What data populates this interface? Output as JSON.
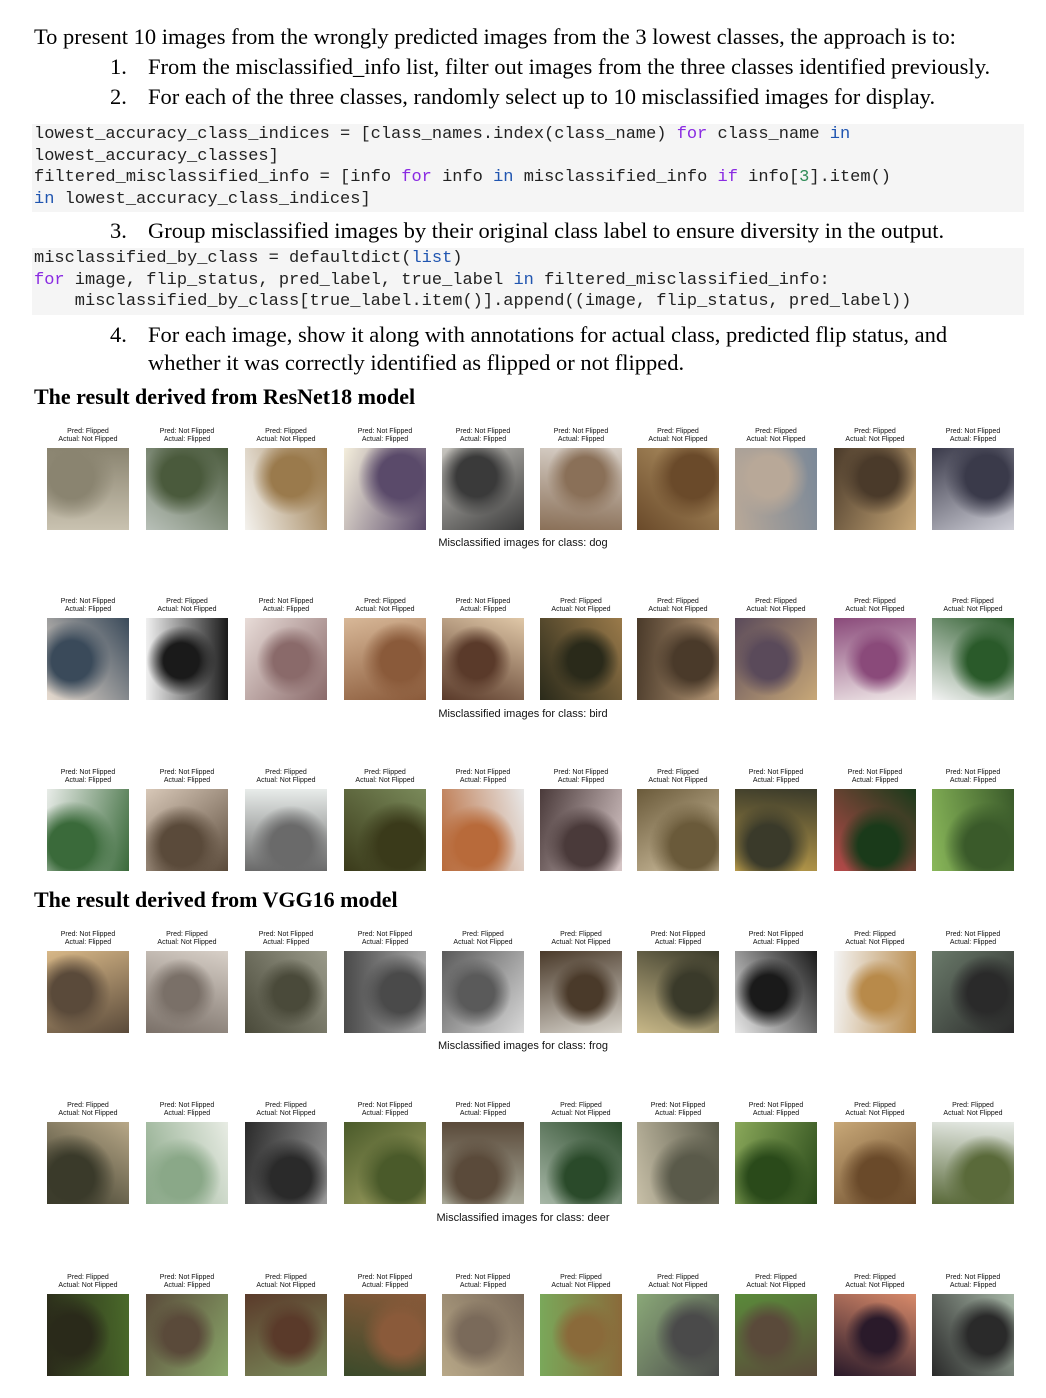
{
  "intro": "To present 10 images from the wrongly predicted images from the 3 lowest classes, the approach is to:",
  "steps": [
    {
      "num": "1.",
      "text": "From the misclassified_info list, filter out images from the three classes identified previously."
    },
    {
      "num": "2.",
      "text": "For each of the three classes, randomly select up to 10 misclassified images for display."
    },
    {
      "num": "3.",
      "text": "Group misclassified images by their original class label to ensure diversity in the output."
    },
    {
      "num": "4.",
      "text": "For each image, show it along with annotations for actual class, predicted flip status, and",
      "text2": "whether it was correctly identified as flipped or not flipped."
    }
  ],
  "code1": [
    [
      "lowest_accuracy_class_indices = [class_names.index(class_name) ",
      "for",
      " class_name ",
      "in"
    ],
    [
      "lowest_accuracy_classes]"
    ],
    [
      "filtered_misclassified_info = [info ",
      "for",
      " info ",
      "in",
      " misclassified_info ",
      "if",
      " info[",
      "3",
      "].item()"
    ],
    [
      "in",
      " lowest_accuracy_class_indices]"
    ]
  ],
  "code2": [
    [
      "misclassified_by_class = defaultdict(",
      "list",
      ")"
    ],
    [
      "for",
      " image, flip_status, pred_label, true_label ",
      "in",
      " filtered_misclassified_info:"
    ],
    [
      "    misclassified_by_class[true_label.item()].append((image, flip_status, pred_label))"
    ]
  ],
  "headings": {
    "resnet": "The result derived from ResNet18 model",
    "vgg": "The result derived from VGG16 model"
  },
  "grids": [
    {
      "title": "Misclassified images for class: dog",
      "items": [
        {
          "p": "Pred: Flipped",
          "a": "Actual: Not Flipped",
          "c1": "#8a8470",
          "c2": "#c9c2b0"
        },
        {
          "p": "Pred: Not Flipped",
          "a": "Actual: Flipped",
          "c1": "#4a5a3c",
          "c2": "#b8c0b8"
        },
        {
          "p": "Pred: Flipped",
          "a": "Actual: Not Flipped",
          "c1": "#9a7a4c",
          "c2": "#f4f2ee"
        },
        {
          "p": "Pred: Not Flipped",
          "a": "Actual: Flipped",
          "c1": "#5a4a6a",
          "c2": "#f4eedc"
        },
        {
          "p": "Pred: Not Flipped",
          "a": "Actual: Flipped",
          "c1": "#3a3a3a",
          "c2": "#c8c6c0"
        },
        {
          "p": "Pred: Not Flipped",
          "a": "Actual: Flipped",
          "c1": "#8a7058",
          "c2": "#d8d0c8"
        },
        {
          "p": "Pred: Flipped",
          "a": "Actual: Not Flipped",
          "c1": "#6a4a2a",
          "c2": "#b89a6a"
        },
        {
          "p": "Pred: Flipped",
          "a": "Actual: Not Flipped",
          "c1": "#b8a898",
          "c2": "#7a8898"
        },
        {
          "p": "Pred: Flipped",
          "a": "Actual: Not Flipped",
          "c1": "#4a3a2a",
          "c2": "#c8a878"
        },
        {
          "p": "Pred: Not Flipped",
          "a": "Actual: Flipped",
          "c1": "#3a3a4a",
          "c2": "#d0d0d8"
        }
      ]
    },
    {
      "title": "Misclassified images for class: bird",
      "items": [
        {
          "p": "Pred: Not Flipped",
          "a": "Actual: Flipped",
          "c1": "#3a4a5a",
          "c2": "#e8dcd0"
        },
        {
          "p": "Pred: Flipped",
          "a": "Actual: Not Flipped",
          "c1": "#1a1a1a",
          "c2": "#f0f0f0"
        },
        {
          "p": "Pred: Not Flipped",
          "a": "Actual: Flipped",
          "c1": "#8a6a6a",
          "c2": "#e8dcd8"
        },
        {
          "p": "Pred: Flipped",
          "a": "Actual: Not Flipped",
          "c1": "#8a5a3a",
          "c2": "#d8b898"
        },
        {
          "p": "Pred: Not Flipped",
          "a": "Actual: Flipped",
          "c1": "#5a3a2a",
          "c2": "#e0c8a8"
        },
        {
          "p": "Pred: Flipped",
          "a": "Actual: Not Flipped",
          "c1": "#2a2a1a",
          "c2": "#9a7a4a"
        },
        {
          "p": "Pred: Flipped",
          "a": "Actual: Not Flipped",
          "c1": "#4a3a2a",
          "c2": "#b89a78"
        },
        {
          "p": "Pred: Flipped",
          "a": "Actual: Not Flipped",
          "c1": "#5a4a5a",
          "c2": "#c8a878"
        },
        {
          "p": "Pred: Flipped",
          "a": "Actual: Not Flipped",
          "c1": "#8a4a7a",
          "c2": "#f0e8e8"
        },
        {
          "p": "Pred: Flipped",
          "a": "Actual: Not Flipped",
          "c1": "#2a5a2a",
          "c2": "#f4f4f4"
        }
      ]
    },
    {
      "title": "",
      "items": [
        {
          "p": "Pred: Not Flipped",
          "a": "Actual: Flipped",
          "c1": "#3a6a3a",
          "c2": "#e8ece8"
        },
        {
          "p": "Pred: Not Flipped",
          "a": "Actual: Flipped",
          "c1": "#5a4a3a",
          "c2": "#d8c8b8"
        },
        {
          "p": "Pred: Flipped",
          "a": "Actual: Not Flipped",
          "c1": "#6a6a6a",
          "c2": "#e8ecea"
        },
        {
          "p": "Pred: Flipped",
          "a": "Actual: Not Flipped",
          "c1": "#3a3a1a",
          "c2": "#7a8a5a"
        },
        {
          "p": "Pred: Not Flipped",
          "a": "Actual: Flipped",
          "c1": "#b86a3a",
          "c2": "#e8e8e8"
        },
        {
          "p": "Pred: Not Flipped",
          "a": "Actual: Flipped",
          "c1": "#4a3a3a",
          "c2": "#d8c8c8"
        },
        {
          "p": "Pred: Flipped",
          "a": "Actual: Not Flipped",
          "c1": "#6a5a3a",
          "c2": "#d8c8a8"
        },
        {
          "p": "Pred: Not Flipped",
          "a": "Actual: Flipped",
          "c1": "#3a3a2a",
          "c2": "#b89a4a"
        },
        {
          "p": "Pred: Not Flipped",
          "a": "Actual: Flipped",
          "c1": "#1a3a1a",
          "c2": "#b84a4a"
        },
        {
          "p": "Pred: Not Flipped",
          "a": "Actual: Flipped",
          "c1": "#3a5a2a",
          "c2": "#8ab85a"
        }
      ]
    },
    {
      "title": "Misclassified images for class: frog",
      "items": [
        {
          "p": "Pred: Not Flipped",
          "a": "Actual: Flipped",
          "c1": "#5a4a3a",
          "c2": "#d8b888"
        },
        {
          "p": "Pred: Flipped",
          "a": "Actual: Not Flipped",
          "c1": "#7a7068",
          "c2": "#d8d0c8"
        },
        {
          "p": "Pred: Not Flipped",
          "a": "Actual: Flipped",
          "c1": "#4a4a3a",
          "c2": "#9a9a8a"
        },
        {
          "p": "Pred: Not Flipped",
          "a": "Actual: Flipped",
          "c1": "#4a4a4a",
          "c2": "#a8a8a8"
        },
        {
          "p": "Pred: Flipped",
          "a": "Actual: Not Flipped",
          "c1": "#5a5a5a",
          "c2": "#d8d8d8"
        },
        {
          "p": "Pred: Flipped",
          "a": "Actual: Not Flipped",
          "c1": "#4a3a2a",
          "c2": "#d8d4cc"
        },
        {
          "p": "Pred: Not Flipped",
          "a": "Actual: Flipped",
          "c1": "#3a3a2a",
          "c2": "#c8b888"
        },
        {
          "p": "Pred: Not Flipped",
          "a": "Actual: Flipped",
          "c1": "#1a1a1a",
          "c2": "#e8e8e8"
        },
        {
          "p": "Pred: Flipped",
          "a": "Actual: Not Flipped",
          "c1": "#b88a4a",
          "c2": "#f4f4f4"
        },
        {
          "p": "Pred: Not Flipped",
          "a": "Actual: Flipped",
          "c1": "#2a2a2a",
          "c2": "#6a7a6a"
        }
      ]
    },
    {
      "title": "Misclassified images for class: deer",
      "items": [
        {
          "p": "Pred: Flipped",
          "a": "Actual: Not Flipped",
          "c1": "#3a3a2a",
          "c2": "#b8a888"
        },
        {
          "p": "Pred: Not Flipped",
          "a": "Actual: Flipped",
          "c1": "#8aa888",
          "c2": "#e8ece4"
        },
        {
          "p": "Pred: Flipped",
          "a": "Actual: Not Flipped",
          "c1": "#2a2a2a",
          "c2": "#9a9a9a"
        },
        {
          "p": "Pred: Not Flipped",
          "a": "Actual: Flipped",
          "c1": "#4a5a2a",
          "c2": "#a8a868"
        },
        {
          "p": "Pred: Not Flipped",
          "a": "Actual: Flipped",
          "c1": "#5a4a3a",
          "c2": "#a8a898"
        },
        {
          "p": "Pred: Flipped",
          "a": "Actual: Not Flipped",
          "c1": "#2a4a2a",
          "c2": "#a8b8a8"
        },
        {
          "p": "Pred: Not Flipped",
          "a": "Actual: Flipped",
          "c1": "#5a5a4a",
          "c2": "#c8c0a8"
        },
        {
          "p": "Pred: Not Flipped",
          "a": "Actual: Flipped",
          "c1": "#2a4a1a",
          "c2": "#8aa85a"
        },
        {
          "p": "Pred: Flipped",
          "a": "Actual: Not Flipped",
          "c1": "#6a4a2a",
          "c2": "#c8a878"
        },
        {
          "p": "Pred: Flipped",
          "a": "Actual: Not Flipped",
          "c1": "#5a6a3a",
          "c2": "#e8ece8"
        }
      ]
    },
    {
      "title": "",
      "items": [
        {
          "p": "Pred: Flipped",
          "a": "Actual: Not Flipped",
          "c1": "#2a2a1a",
          "c2": "#4a6a2a"
        },
        {
          "p": "Pred: Not Flipped",
          "a": "Actual: Flipped",
          "c1": "#5a4a3a",
          "c2": "#8aa86a"
        },
        {
          "p": "Pred: Flipped",
          "a": "Actual: Not Flipped",
          "c1": "#5a3a2a",
          "c2": "#7a8a5a"
        },
        {
          "p": "Pred: Not Flipped",
          "a": "Actual: Flipped",
          "c1": "#8a5a3a",
          "c2": "#3a4a2a"
        },
        {
          "p": "Pred: Not Flipped",
          "a": "Actual: Flipped",
          "c1": "#7a6a5a",
          "c2": "#b8a888"
        },
        {
          "p": "Pred: Flipped",
          "a": "Actual: Not Flipped",
          "c1": "#8a6a3a",
          "c2": "#7aa85a"
        },
        {
          "p": "Pred: Flipped",
          "a": "Actual: Not Flipped",
          "c1": "#4a4a4a",
          "c2": "#8aa878"
        },
        {
          "p": "Pred: Flipped",
          "a": "Actual: Not Flipped",
          "c1": "#5a4a3a",
          "c2": "#5a8a3a"
        },
        {
          "p": "Pred: Flipped",
          "a": "Actual: Not Flipped",
          "c1": "#2a1a2a",
          "c2": "#d88a6a"
        },
        {
          "p": "Pred: Not Flipped",
          "a": "Actual: Flipped",
          "c1": "#2a2a2a",
          "c2": "#a8b8a8"
        }
      ]
    }
  ]
}
